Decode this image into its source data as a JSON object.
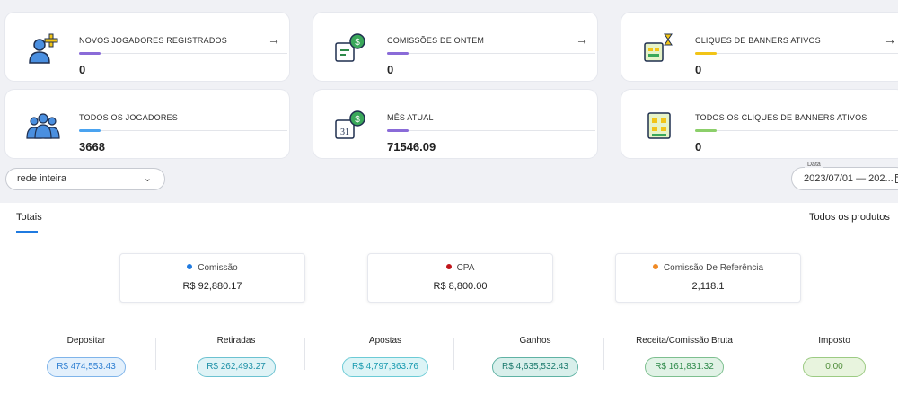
{
  "cards": [
    {
      "label": "NOVOS JOGADORES REGISTRADOS",
      "value": "0",
      "accent": "#8a6bd8",
      "icon": "user-add-icon",
      "arrow": "→"
    },
    {
      "label": "COMISSÕES DE ONTEM",
      "value": "0",
      "accent": "#8a6bd8",
      "icon": "calendar-money-icon",
      "arrow": "→"
    },
    {
      "label": "CLIQUES DE BANNERS ATIVOS",
      "value": "0",
      "accent": "#f2c417",
      "icon": "banner-clicks-icon",
      "arrow": "→"
    },
    {
      "label": "TODOS OS JOGADORES",
      "value": "3668",
      "accent": "#4aa3f0",
      "icon": "users-group-icon"
    },
    {
      "label": "MÊS ATUAL",
      "value": "71546.09",
      "accent": "#8a6bd8",
      "icon": "calendar-31-money-icon"
    },
    {
      "label": "TODOS OS CLIQUES DE BANNERS ATIVOS",
      "value": "0",
      "accent": "#8ccf6a",
      "icon": "banners-all-icon"
    }
  ],
  "filter": {
    "value": "rede inteira",
    "chevron": "⌄"
  },
  "date": {
    "label": "Data",
    "value": "2023/07/01 — 202..."
  },
  "tabs": {
    "active": "Totais",
    "products": "Todos os produtos"
  },
  "summary": [
    {
      "title": "Comissão",
      "value": "R$ 92,880.17",
      "dot": "#1f7ae0"
    },
    {
      "title": "CPA",
      "value": "R$ 8,800.00",
      "dot": "#c0161b"
    },
    {
      "title": "Comissão De Referência",
      "value": "2,118.1",
      "dot": "#f08a24"
    }
  ],
  "metrics": [
    {
      "title": "Depositar",
      "value": "R$ 474,553.43",
      "color": "#2f7fd1",
      "bg": "#e3f0fc"
    },
    {
      "title": "Retiradas",
      "value": "R$ 262,493.27",
      "color": "#1b8fa6",
      "bg": "#dff3f6"
    },
    {
      "title": "Apostas",
      "value": "R$ 4,797,363.76",
      "color": "#1a9bb0",
      "bg": "#dcf4f6"
    },
    {
      "title": "Ganhos",
      "value": "R$ 4,635,532.43",
      "color": "#1c7a6e",
      "bg": "#d8efeb"
    },
    {
      "title": "Receita/Comissão Bruta",
      "value": "R$ 161,831.32",
      "color": "#2e8a4a",
      "bg": "#e1f2e6"
    },
    {
      "title": "Imposto",
      "value": "0.00",
      "color": "#4f8d3a",
      "bg": "#e8f4de"
    }
  ]
}
